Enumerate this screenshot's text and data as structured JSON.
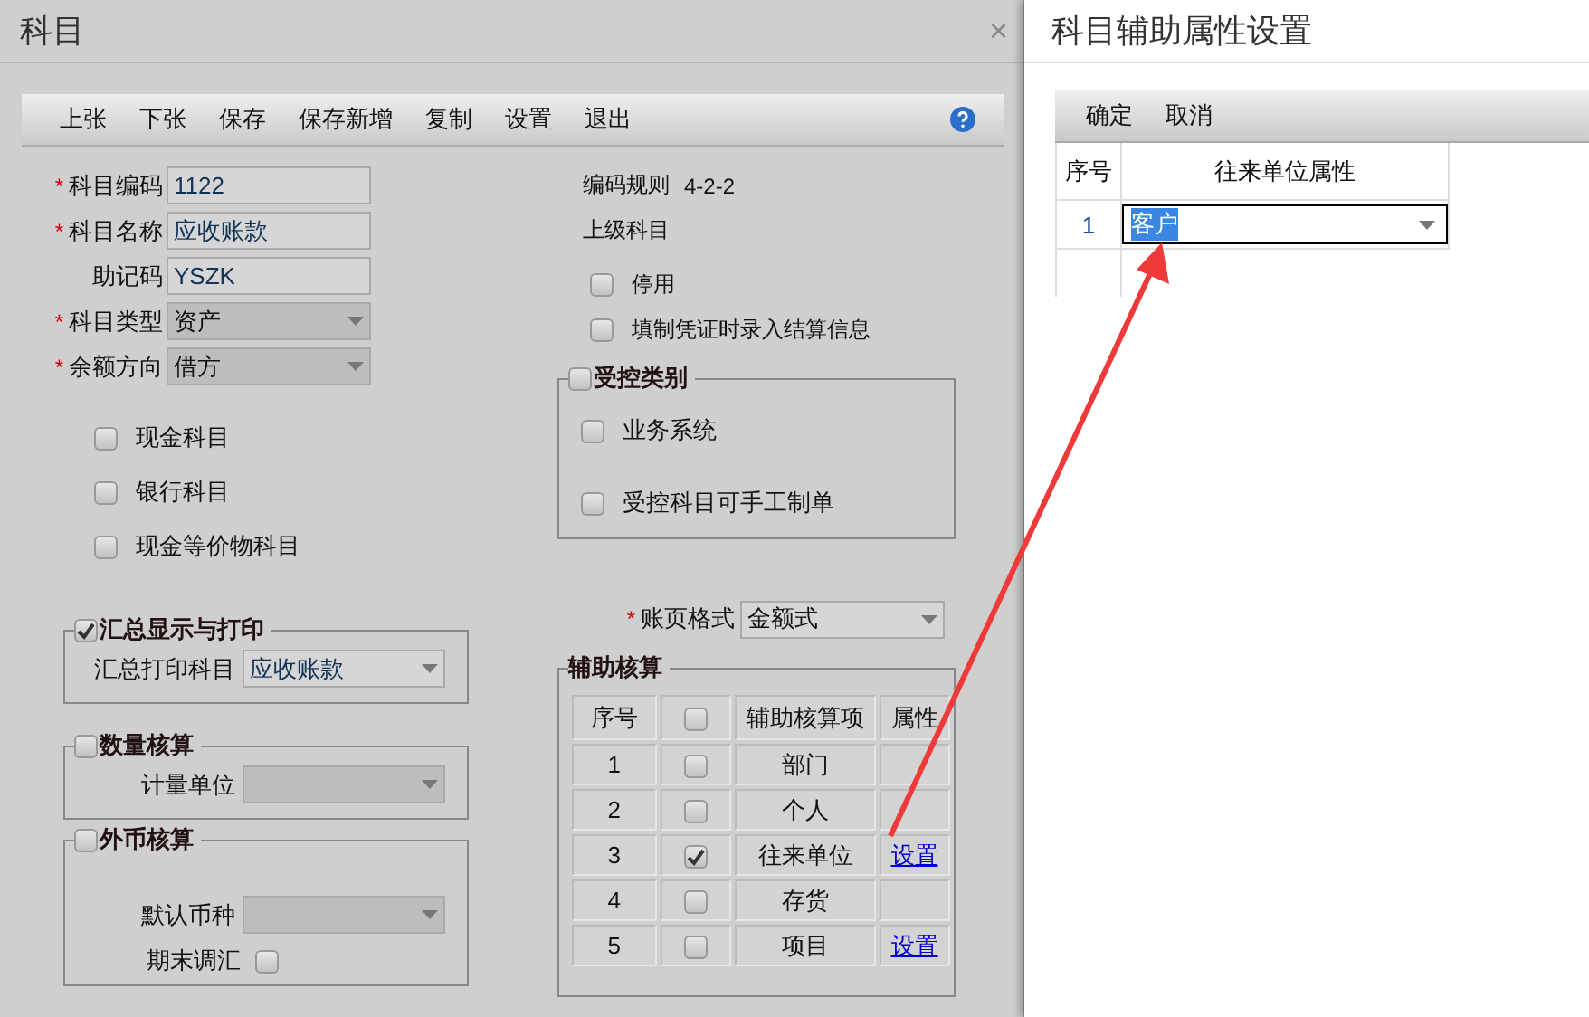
{
  "main_window": {
    "title": "科目",
    "close": "×",
    "toolbar": [
      "上张",
      "下张",
      "保存",
      "保存新增",
      "复制",
      "设置",
      "退出"
    ],
    "fields": [
      {
        "required_mark": "*",
        "label": "科目编码",
        "kind": "text",
        "value": "1122",
        "disabled": false
      },
      {
        "required_mark": "*",
        "label": "科目名称",
        "kind": "text",
        "value": "应收账款",
        "disabled": false
      },
      {
        "label": "助记码",
        "kind": "text",
        "value": "YSZK",
        "disabled": false
      },
      {
        "required_mark": "*",
        "label": "科目类型",
        "kind": "select",
        "value": "资产",
        "disabled": true
      },
      {
        "required_mark": "*",
        "label": "余额方向",
        "kind": "select",
        "value": "借方",
        "disabled": true
      }
    ],
    "account_checkboxes": [
      {
        "label": "现金科目",
        "checked": false
      },
      {
        "label": "银行科目",
        "checked": false
      },
      {
        "label": "现金等价物科目",
        "checked": false
      }
    ],
    "summary_group": {
      "title": "汇总显示与打印",
      "checked": true,
      "field": {
        "label": "汇总打印科目",
        "value": "应收账款",
        "disabled": false
      }
    },
    "quantity_group": {
      "title": "数量核算",
      "checked": false,
      "field": {
        "label": "计量单位",
        "disabled": true
      }
    },
    "currency_group": {
      "title": "外币核算",
      "checked": false,
      "field": {
        "label": "默认币种",
        "disabled": true
      },
      "period_adjust": {
        "label": "期末调汇",
        "checked": false
      }
    },
    "code_rule": {
      "label": "编码规则",
      "value": "4-2-2"
    },
    "parent_label": "上级科目",
    "option_checkboxes": [
      {
        "label": "停用",
        "checked": false
      },
      {
        "label": "填制凭证时录入结算信息",
        "checked": false
      }
    ],
    "controlled_group": {
      "title": "受控类别",
      "checked": false,
      "options": [
        {
          "label": "业务系统",
          "checked": false
        },
        {
          "label": "受控科目可手工制单",
          "checked": false
        }
      ]
    },
    "ledger_format": {
      "required_mark": "*",
      "label": "账页格式",
      "value": "金额式"
    },
    "auxiliary": {
      "title": "辅助核算",
      "columns": [
        "序号",
        "辅助核算项",
        "属性"
      ],
      "header_checked": false,
      "rows": [
        {
          "no": "1",
          "checked": false,
          "item": "部门"
        },
        {
          "no": "2",
          "checked": false,
          "item": "个人"
        },
        {
          "no": "3",
          "checked": true,
          "item": "往来单位",
          "link": "设置"
        },
        {
          "no": "4",
          "checked": false,
          "item": "存货"
        },
        {
          "no": "5",
          "checked": false,
          "item": "项目",
          "link": "设置"
        }
      ]
    }
  },
  "dialog": {
    "title": "科目辅助属性设置",
    "toolbar": [
      "确定",
      "取消"
    ],
    "columns": [
      "序号",
      "往来单位属性"
    ],
    "rows": [
      {
        "no": "1",
        "value": "客户",
        "selected": true
      }
    ]
  }
}
